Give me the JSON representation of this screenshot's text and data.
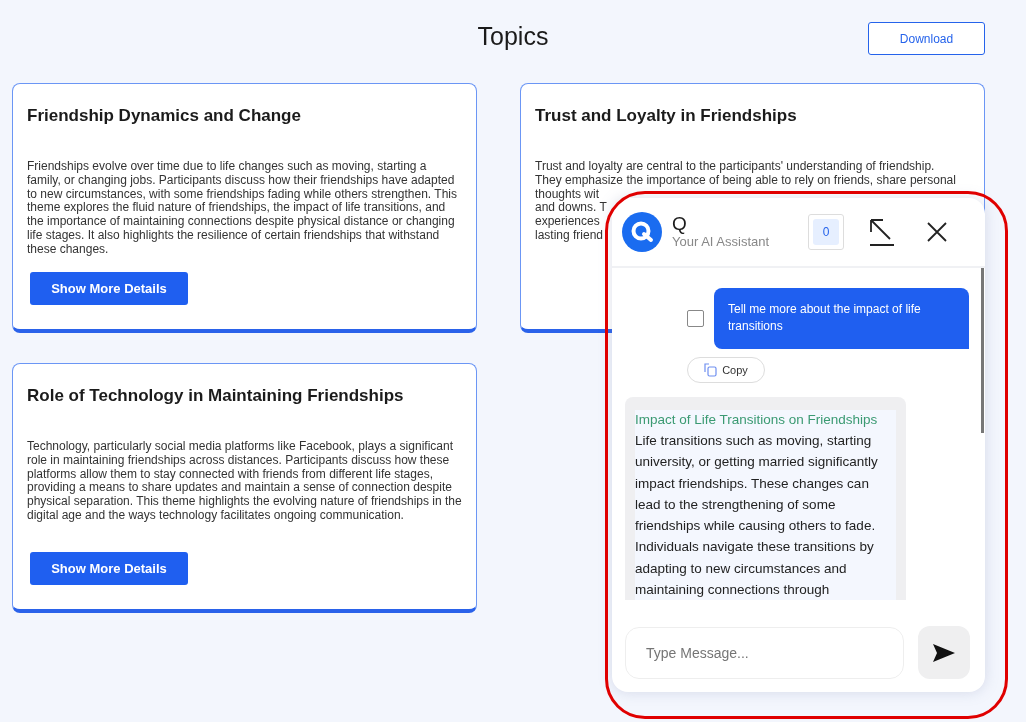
{
  "page": {
    "title": "Topics",
    "download_button": "Download"
  },
  "topics": [
    {
      "title": "Friendship Dynamics and Change",
      "body": "Friendships evolve over time due to life changes such as moving, starting a family, or changing jobs. Participants discuss how their friendships have adapted to new circumstances, with some friendships fading while others strengthen. This theme explores the fluid nature of friendships, the impact of life transitions, and the importance of maintaining connections despite physical distance or changing life stages. It also highlights the resilience of certain friendships that withstand these changes.",
      "button": "Show More Details"
    },
    {
      "title": "Trust and Loyalty in Friendships",
      "body_lines": [
        "Trust and loyalty are central to the participants' understanding of friendship.",
        "They emphasize the importance of being able to rely on friends, share personal",
        "thoughts wit",
        "and downs. T",
        "experiences",
        "lasting friend"
      ]
    },
    {
      "title": "Role of Technology in Maintaining Friendships",
      "body": "Technology, particularly social media platforms like Facebook, plays a significant role in maintaining friendships across distances. Participants discuss how these platforms allow them to stay connected with friends from different life stages, providing a means to share updates and maintain a sense of connection despite physical separation. This theme highlights the evolving nature of friendships in the digital age and the ways technology facilitates ongoing communication.",
      "button": "Show More Details"
    }
  ],
  "chat": {
    "name": "Q",
    "subtitle": "Your AI Assistant",
    "count": "0",
    "messages": [
      {
        "kind": "user",
        "text": "Tell me more about the impact of life transitions",
        "checked": false,
        "copy_label": "Copy"
      },
      {
        "kind": "bot",
        "heading": "Impact of Life Transitions on Friendships",
        "text": "Life transitions such as moving, starting university, or getting married significantly impact friendships. These changes can lead to the strengthening of some friendships while causing others to fade. Individuals navigate these transitions by adapting to new circumstances and maintaining connections through"
      }
    ],
    "input": {
      "placeholder": "Type Message..."
    }
  }
}
